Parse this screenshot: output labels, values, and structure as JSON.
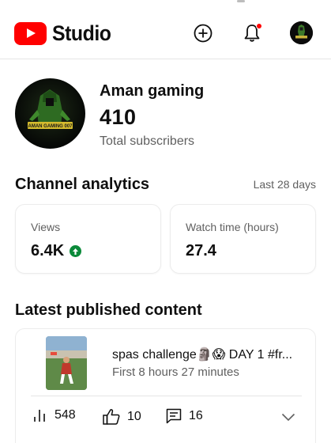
{
  "header": {
    "app_name": "Studio",
    "create_icon": "add-circle-icon",
    "notifications_icon": "bell-icon",
    "accent": "#ff0000"
  },
  "channel": {
    "name": "Aman gaming",
    "subscribers": "410",
    "subscribers_label": "Total subscribers",
    "avatar_text": "AMAN GAMING 007"
  },
  "analytics": {
    "title": "Channel analytics",
    "period": "Last 28 days",
    "views_label": "Views",
    "views_value": "6.4K",
    "views_trend": "up",
    "watch_label": "Watch time (hours)",
    "watch_value": "27.4",
    "trend_color": "#0b8a3a"
  },
  "latest": {
    "title": "Latest published content",
    "video_title": "spas challenge🗿😱 DAY 1 #fr...",
    "video_meta": "First 8 hours 27 minutes",
    "views": "548",
    "likes": "10",
    "comments": "16"
  }
}
